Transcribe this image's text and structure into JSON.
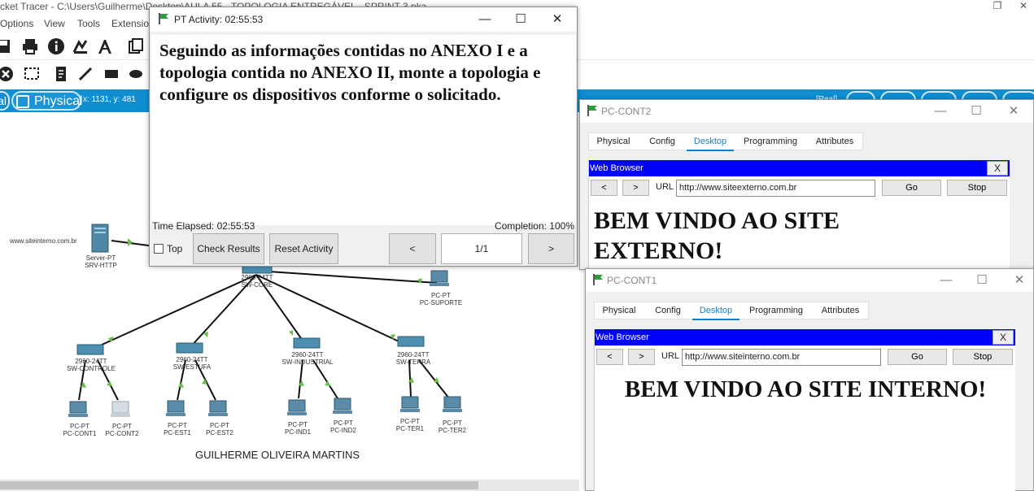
{
  "main": {
    "title": "cket Tracer - C:\\Users\\Guilherme\\Desktop\\AULA 55 - TOPOLOGIA ENTREGÁVEL - SPRINT 3.pka",
    "menu": [
      "Options",
      "View",
      "Tools",
      "Extensions"
    ],
    "physical_tab": "Physical",
    "logical_fragment": "al",
    "coords": "x: 1131, y: 481",
    "realtime_fragment": "[Real]"
  },
  "activity": {
    "title": "PT Activity: 02:55:53",
    "instructions": "Seguindo as informações contidas no ANEXO I e a topologia contida no ANEXO II, monte a topologia e configure os dispositivos  conforme o solicitado.",
    "elapsed": "Time Elapsed: 02:55:53",
    "completion": "Completion: 100%",
    "top_label": "Top",
    "check_results": "Check Results",
    "reset_activity": "Reset Activity",
    "prev": "<",
    "page": "1/1",
    "next": ">"
  },
  "topology": {
    "site_note": "www.siteinterno.com.br",
    "server": {
      "type": "Server-PT",
      "name": "SRV-HTTP"
    },
    "core": {
      "model": "2960-24TT",
      "name": "SW-CORE"
    },
    "suporte": {
      "type": "PC-PT",
      "name": "PC-SUPORTE"
    },
    "switches": [
      {
        "model": "2960-24TT",
        "name": "SW-CONTROLE"
      },
      {
        "model": "2960-24TT",
        "name": "SW-ESTUFA"
      },
      {
        "model": "2960-24TT",
        "name": "SW-INDUSTRIAL"
      },
      {
        "model": "2960-24TT",
        "name": "SW-TERRA"
      }
    ],
    "pcs": [
      {
        "type": "PC-PT",
        "name": "PC-CONT1"
      },
      {
        "type": "PC-PT",
        "name": "PC-CONT2"
      },
      {
        "type": "PC-PT",
        "name": "PC-EST1"
      },
      {
        "type": "PC-PT",
        "name": "PC-EST2"
      },
      {
        "type": "PC-PT",
        "name": "PC-IND1"
      },
      {
        "type": "PC-PT",
        "name": "PC-IND2"
      },
      {
        "type": "PC-PT",
        "name": "PC-TER1"
      },
      {
        "type": "PC-PT",
        "name": "PC-TER2"
      }
    ],
    "author": "GUILHERME OLIVEIRA MARTINS"
  },
  "pc_cont2": {
    "title": "PC-CONT2",
    "tabs": [
      "Physical",
      "Config",
      "Desktop",
      "Programming",
      "Attributes"
    ],
    "browser_title": "Web Browser",
    "close": "X",
    "back": "<",
    "forward": ">",
    "url_label": "URL",
    "url": "http://www.siteexterno.com.br",
    "go": "Go",
    "stop": "Stop",
    "heading": "BEM VINDO AO SITE EXTERNO!"
  },
  "pc_cont1": {
    "title": "PC-CONT1",
    "tabs": [
      "Physical",
      "Config",
      "Desktop",
      "Programming",
      "Attributes"
    ],
    "browser_title": "Web Browser",
    "close": "X",
    "back": "<",
    "forward": ">",
    "url_label": "URL",
    "url": "http://www.siteinterno.com.br",
    "go": "Go",
    "stop": "Stop",
    "heading": "BEM VINDO AO SITE INTERNO!"
  },
  "colors": {
    "accent_bar": "#0f8ed2",
    "link_green": "#6abf4b",
    "browser_head": "#0000ff",
    "active_tab": "#1a7ec5"
  }
}
